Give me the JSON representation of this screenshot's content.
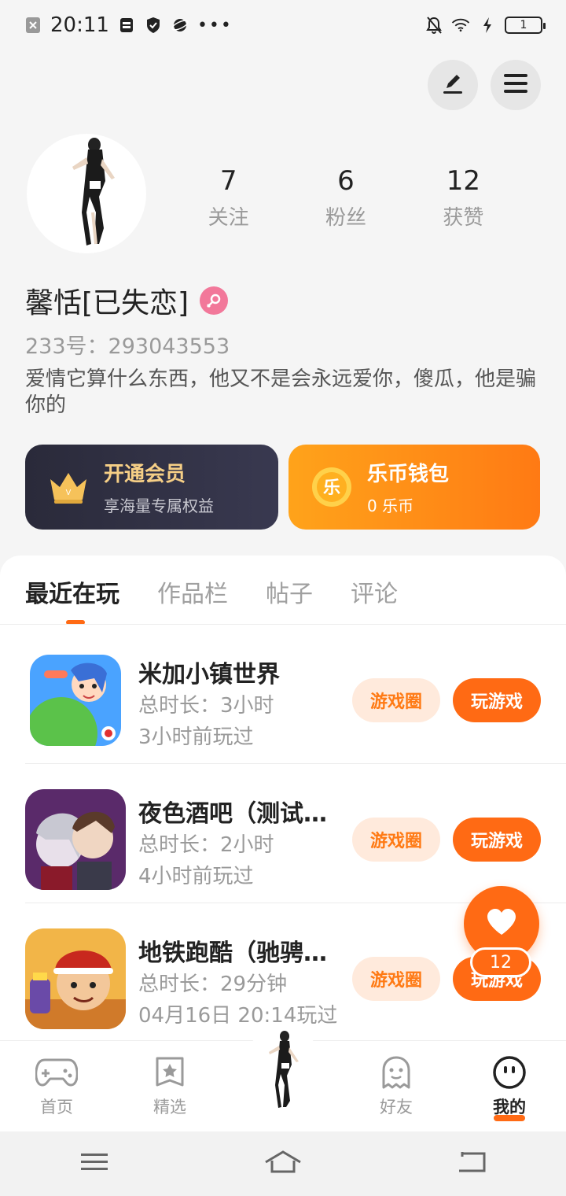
{
  "status_bar": {
    "time": "20:11",
    "battery": "1"
  },
  "profile": {
    "stats": [
      {
        "value": "7",
        "label": "关注"
      },
      {
        "value": "6",
        "label": "粉丝"
      },
      {
        "value": "12",
        "label": "获赞"
      }
    ],
    "nickname": "馨恬[已失恋]",
    "uid": "233号：293043553",
    "bio": "爱情它算什么东西，他又不是会永远爱你，傻瓜，他是骗你的"
  },
  "cards": {
    "vip": {
      "title": "开通会员",
      "subtitle": "享海量专属权益"
    },
    "wallet": {
      "title": "乐币钱包",
      "subtitle": "0 乐币",
      "coin_char": "乐"
    }
  },
  "tabs": [
    "最近在玩",
    "作品栏",
    "帖子",
    "评论"
  ],
  "games": [
    {
      "name": "米加小镇世界",
      "duration": "总时长：3小时",
      "last_played": "3小时前玩过",
      "circle_label": "游戏圈",
      "play_label": "玩游戏"
    },
    {
      "name": "夜色酒吧（测试…",
      "duration": "总时长：2小时",
      "last_played": "4小时前玩过",
      "circle_label": "游戏圈",
      "play_label": "玩游戏"
    },
    {
      "name": "地铁跑酷（驰骋…",
      "duration": "总时长：29分钟",
      "last_played": "04月16日 20:14玩过",
      "circle_label": "游戏圈",
      "play_label": "玩游戏"
    }
  ],
  "like_fab": {
    "count": "12"
  },
  "bottom_nav": [
    {
      "label": "首页",
      "icon": "gamepad-icon"
    },
    {
      "label": "精选",
      "icon": "star-badge-icon"
    },
    {
      "label": "好友",
      "icon": "ghost-icon"
    },
    {
      "label": "我的",
      "icon": "smile-face-icon"
    }
  ],
  "colors": {
    "accent": "#ff6a14",
    "vip_gold": "#f6cf86",
    "gender_pink": "#f2789a"
  }
}
